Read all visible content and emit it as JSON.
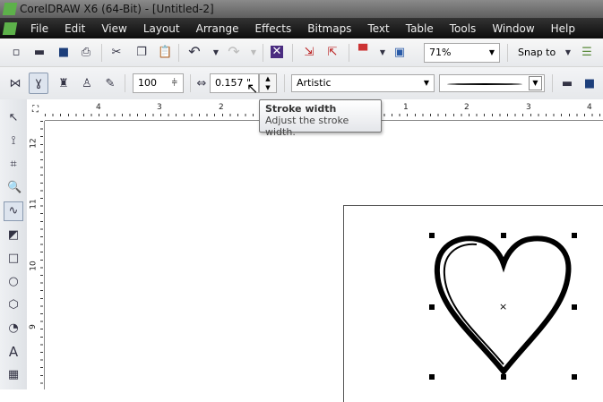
{
  "window": {
    "title": "CorelDRAW X6 (64-Bit) - [Untitled-2]"
  },
  "menu": [
    "File",
    "Edit",
    "View",
    "Layout",
    "Arrange",
    "Effects",
    "Bitmaps",
    "Text",
    "Table",
    "Tools",
    "Window",
    "Help"
  ],
  "toolbar": {
    "zoom": "71%",
    "snap": "Snap to"
  },
  "propbar": {
    "smoothing": "100",
    "stroke_width": "0.157 \"",
    "preset": "Artistic"
  },
  "tooltip": {
    "title": "Stroke width",
    "text": "Adjust the stroke width."
  },
  "ruler_h": [
    "4",
    "3",
    "2",
    "1",
    "2",
    "3",
    "4"
  ],
  "ruler_v": [
    "12",
    "11",
    "10",
    "9"
  ]
}
